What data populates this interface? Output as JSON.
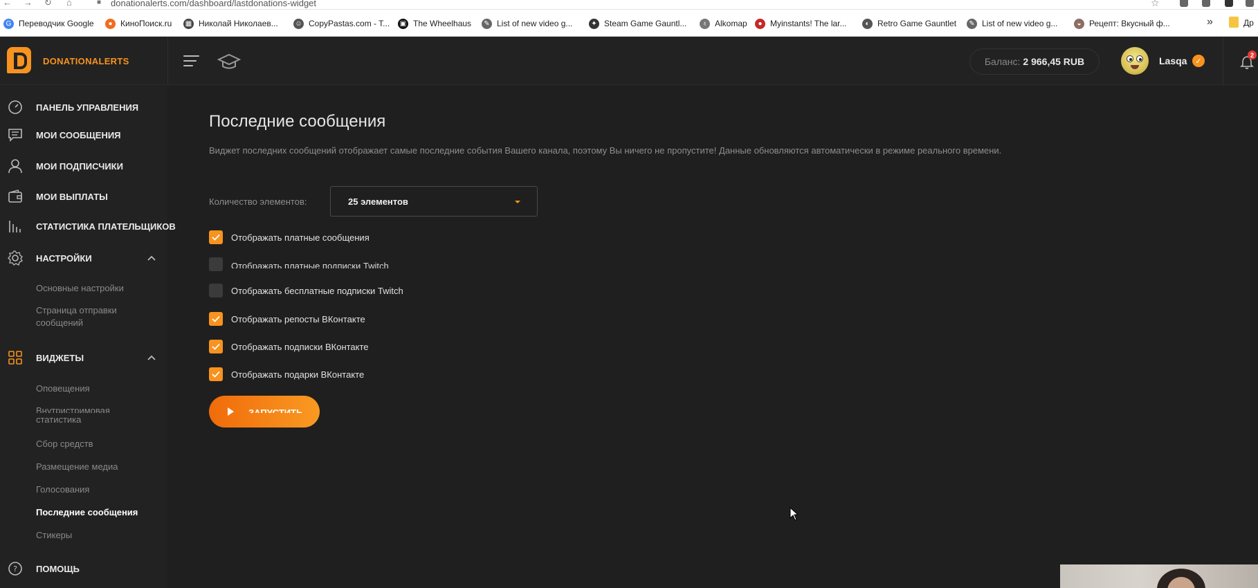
{
  "browser": {
    "url": "donationalerts.com/dashboard/lastdonations-widget",
    "bookmarks": [
      {
        "label": "Переводчик Google",
        "color": "#4285f4",
        "glyph": "G"
      },
      {
        "label": "КиноПоиск.ru",
        "color": "#f26b1d",
        "glyph": "●"
      },
      {
        "label": "Николай Николаев...",
        "color": "#444444",
        "glyph": "▦"
      },
      {
        "label": "CopyPastas.com - T...",
        "color": "#555555",
        "glyph": "☺"
      },
      {
        "label": "The Wheelhaus",
        "color": "#111111",
        "glyph": "▣"
      },
      {
        "label": "List of new video g...",
        "color": "#666666",
        "glyph": "✎"
      },
      {
        "label": "Steam Game Gauntl...",
        "color": "#333333",
        "glyph": "✦"
      },
      {
        "label": "Alkomap",
        "color": "#777777",
        "glyph": "♁"
      },
      {
        "label": "Myinstants! The lar...",
        "color": "#c62828",
        "glyph": "●"
      },
      {
        "label": "Retro Game Gauntlet",
        "color": "#555555",
        "glyph": "◐"
      },
      {
        "label": "List of new video g...",
        "color": "#666666",
        "glyph": "✎"
      },
      {
        "label": "Рецепт: Вкусный ф...",
        "color": "#8d6e63",
        "glyph": "◒"
      }
    ],
    "bookmarks_more": "»",
    "bookmarks_last": "Др"
  },
  "header": {
    "brand": "DONATIONALERTS",
    "balance_label": "Баланс:",
    "balance_value": "2 966,45 RUB",
    "username": "Lasqa",
    "verified_mark": "✓",
    "notifications_count": "2"
  },
  "sidebar": {
    "items": [
      {
        "label": "ПАНЕЛЬ УПРАВЛЕНИЯ",
        "icon": "gauge-icon"
      },
      {
        "label": "МОИ СООБЩЕНИЯ",
        "icon": "message-icon"
      },
      {
        "label": "МОИ ПОДПИСЧИКИ",
        "icon": "user-icon"
      },
      {
        "label": "МОИ ВЫПЛАТЫ",
        "icon": "wallet-icon"
      },
      {
        "label": "СТАТИСТИКА ПЛАТЕЛЬЩИКОВ",
        "icon": "bar-chart-icon"
      },
      {
        "label": "НАСТРОЙКИ",
        "icon": "gear-icon"
      },
      {
        "label": "ВИДЖЕТЫ",
        "icon": "grid-icon"
      },
      {
        "label": "ПОМОЩЬ",
        "icon": "help-icon"
      }
    ],
    "settings_sub": [
      "Основные настройки",
      "Страница отправки сообщений"
    ],
    "widgets_sub": [
      "Оповещения",
      "Внутристримовая статистика",
      "Сбор средств",
      "Размещение медиа",
      "Голосования",
      "Последние сообщения",
      "Стикеры"
    ]
  },
  "main": {
    "title": "Последние сообщения",
    "description": "Виджет последних сообщений отображает самые последние события Вашего канала, поэтому Вы ничего не пропустите! Данные обновляются автоматически в режиме реального времени.",
    "count_label": "Количество элементов:",
    "count_value": "25 элементов",
    "options": [
      {
        "label": "Отображать платные сообщения",
        "checked": true
      },
      {
        "label": "Отображать платные подписки Twitch",
        "checked": false
      },
      {
        "label": "Отображать бесплатные подписки Twitch",
        "checked": false
      },
      {
        "label": "Отображать репосты ВКонтакте",
        "checked": true
      },
      {
        "label": "Отображать подписки ВКонтакте",
        "checked": true
      },
      {
        "label": "Отображать подарки ВКонтакте",
        "checked": true
      }
    ],
    "launch_label": "ЗАПУСТИТЬ"
  },
  "colors": {
    "accent": "#f7931e",
    "background": "#1f1f1f",
    "sidebar": "#222222"
  }
}
